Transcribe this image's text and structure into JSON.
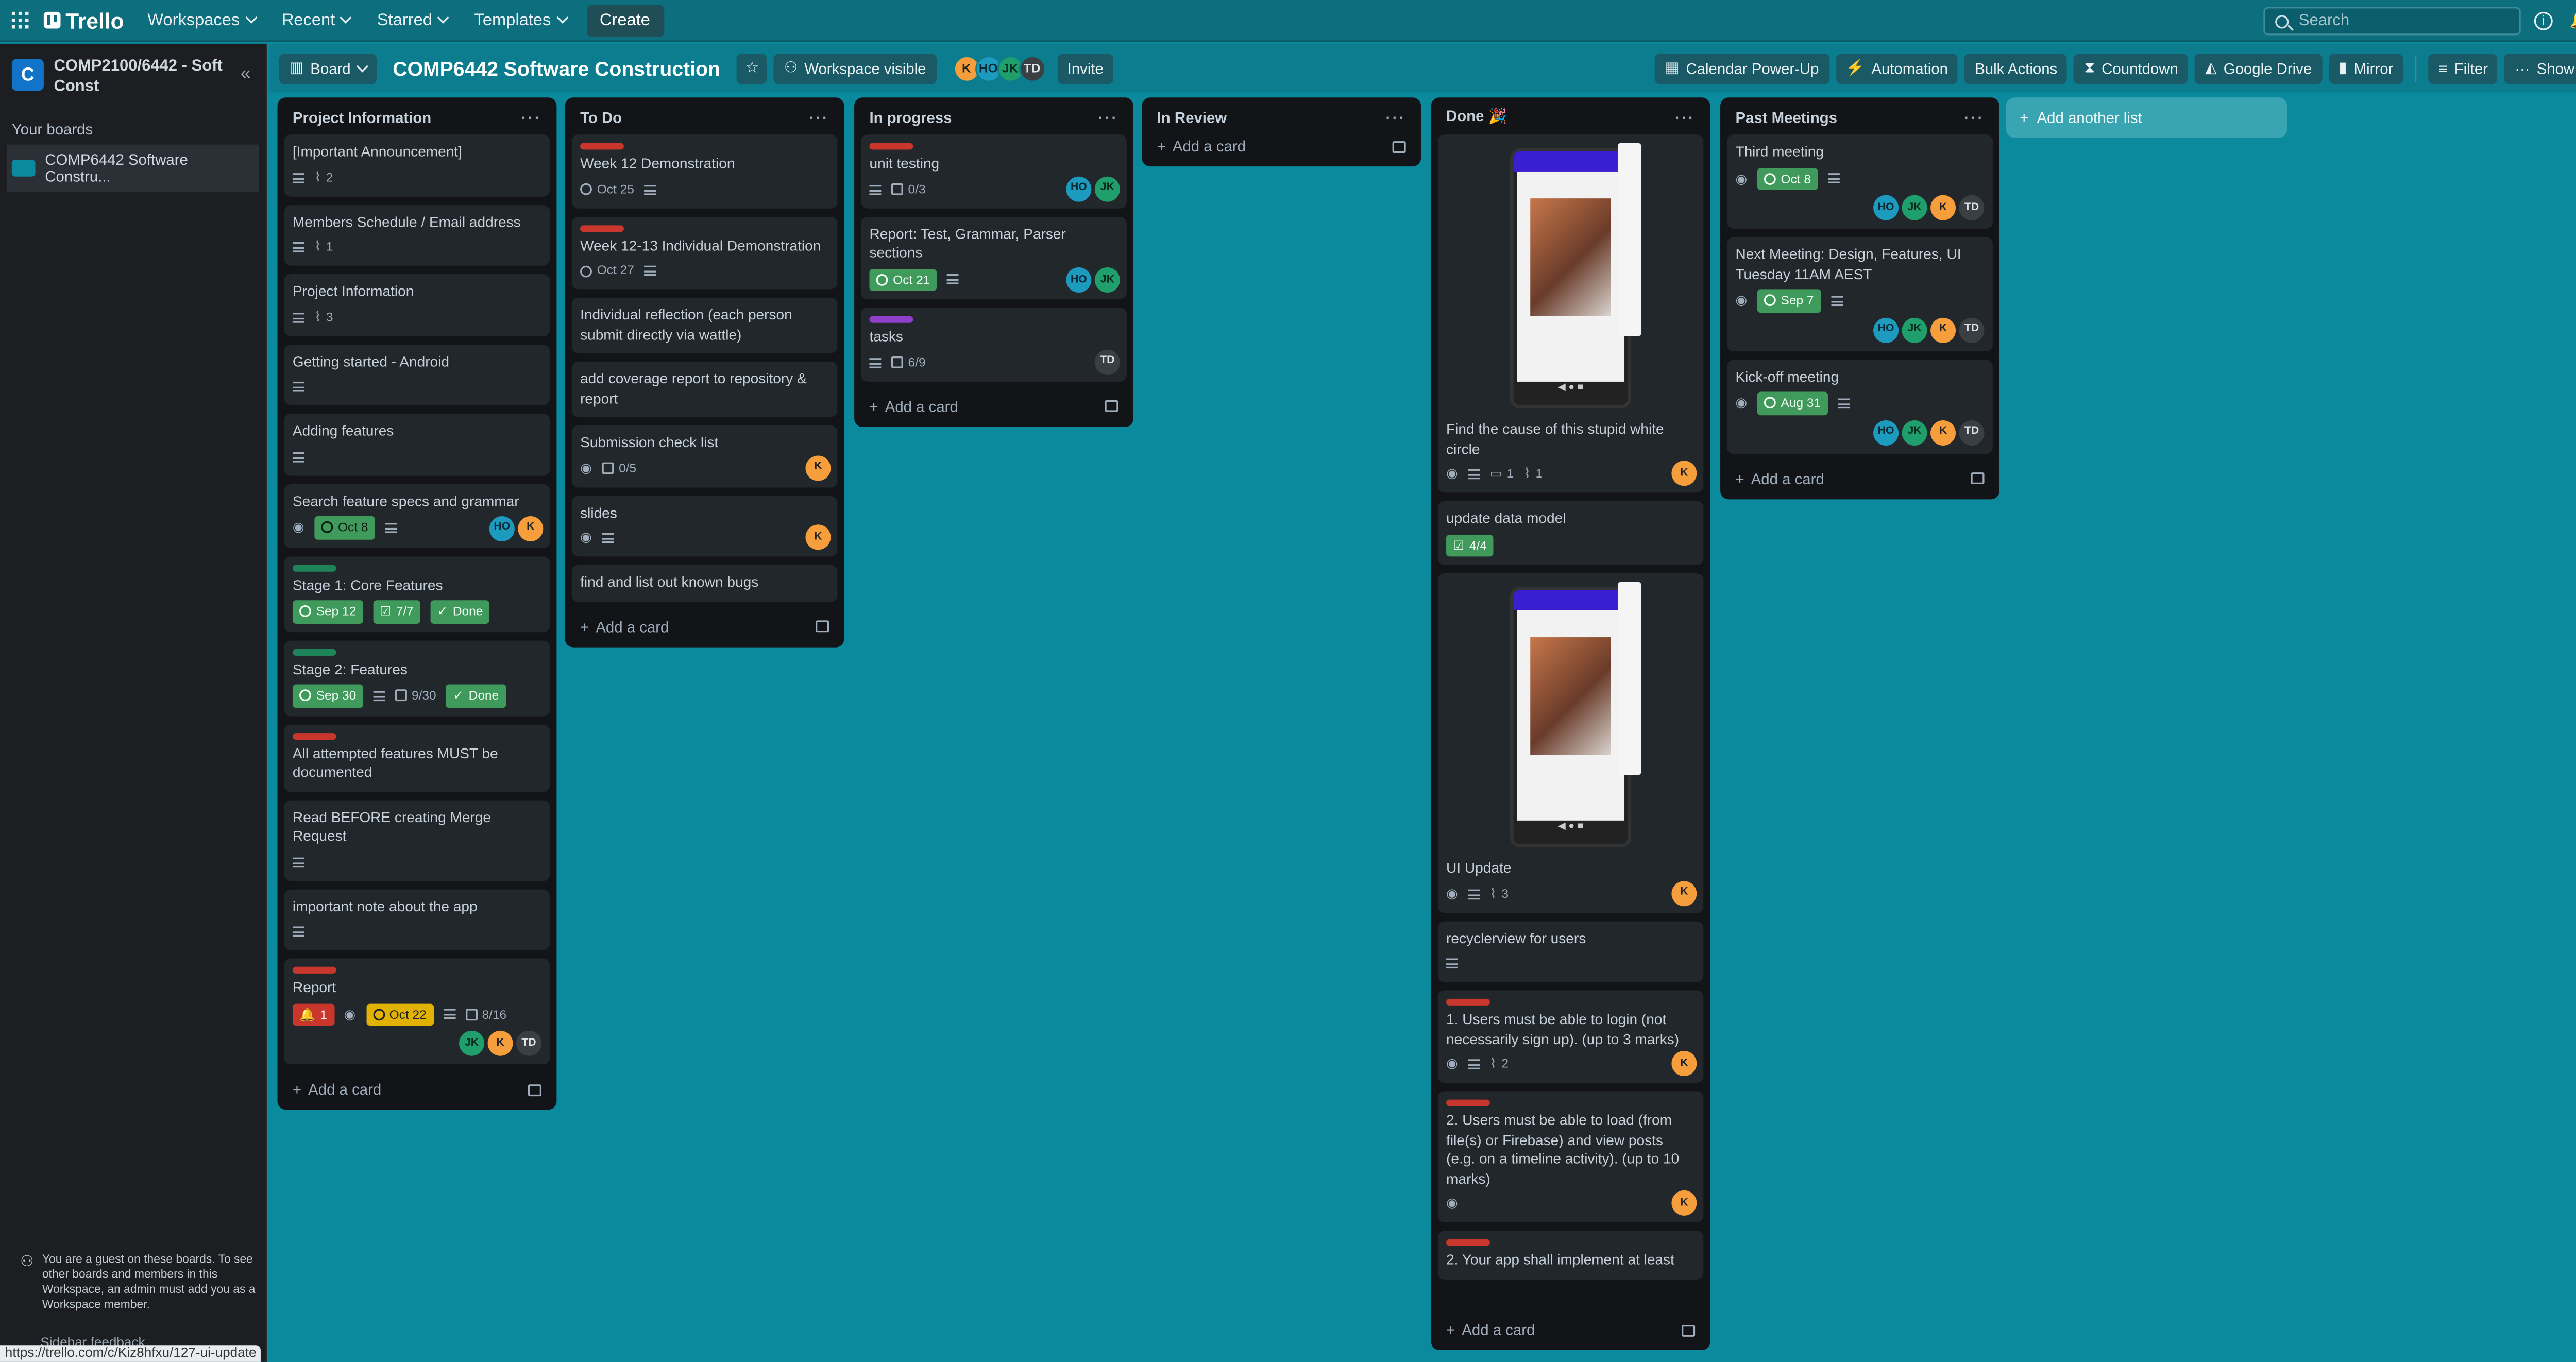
{
  "topbar": {
    "logo": "Trello",
    "nav": [
      "Workspaces",
      "Recent",
      "Starred",
      "Templates"
    ],
    "create": "Create",
    "search_placeholder": "Search",
    "user_initial": "K"
  },
  "sidebar": {
    "workspace_initial": "C",
    "workspace_name": "COMP2100/6442 - Soft Const",
    "your_boards": "Your boards",
    "board": "COMP6442 Software Constru...",
    "guest_note": "You are a guest on these boards. To see other boards and members in this Workspace, an admin must add you as a Workspace member.",
    "feedback": "Sidebar feedback"
  },
  "status_url": "https://trello.com/c/Kiz8hfxu/127-ui-update",
  "board": {
    "view": "Board",
    "title": "COMP6442 Software Construction",
    "visibility": "Workspace visible",
    "members": [
      "K",
      "HO",
      "JK",
      "TD"
    ],
    "invite": "Invite",
    "actions": [
      "Calendar Power-Up",
      "Automation",
      "Bulk Actions",
      "Countdown",
      "Google Drive",
      "Mirror"
    ],
    "filter": "Filter",
    "show_menu": "Show menu"
  },
  "add_card": "Add a card",
  "add_list": "Add another list",
  "lists": {
    "project_info": {
      "title": "Project Information",
      "cards": [
        {
          "title": "[Important Announcement]",
          "attach": "2"
        },
        {
          "title": "Members Schedule / Email address",
          "attach": "1"
        },
        {
          "title": "Project Information",
          "attach": "3"
        },
        {
          "title": "Getting started - Android"
        },
        {
          "title": "Adding features"
        },
        {
          "title": "Search feature specs and grammar",
          "date": "Oct 8"
        },
        {
          "title": "Stage 1: Core Features",
          "date": "Sep 12",
          "check": "7/7",
          "done": "Done"
        },
        {
          "title": "Stage 2: Features",
          "date": "Sep 30",
          "check": "9/30",
          "done": "Done"
        },
        {
          "title": "All attempted features MUST be documented"
        },
        {
          "title": "Read BEFORE creating Merge Request"
        },
        {
          "title": "important note about the app"
        },
        {
          "title": "Report",
          "notify": "1",
          "date": "Oct 22",
          "check": "8/16"
        }
      ]
    },
    "todo": {
      "title": "To Do",
      "cards": [
        {
          "title": "Week 12 Demonstration",
          "date": "Oct 25"
        },
        {
          "title": "Week 12-13 Individual Demonstration",
          "date": "Oct 27"
        },
        {
          "title": "Individual reflection (each person submit directly via wattle)"
        },
        {
          "title": "add coverage report to repository & report"
        },
        {
          "title": "Submission check list",
          "check": "0/5"
        },
        {
          "title": "slides"
        },
        {
          "title": "find and list out known bugs"
        }
      ]
    },
    "in_progress": {
      "title": "In progress",
      "cards": [
        {
          "title": "unit testing",
          "check": "0/3"
        },
        {
          "title": "Report: Test, Grammar, Parser sections",
          "date": "Oct 21"
        },
        {
          "title": "tasks",
          "check": "6/9"
        }
      ]
    },
    "in_review": {
      "title": "In Review"
    },
    "done": {
      "title": "Done 🎉",
      "cards": [
        {
          "title": "Find the cause of this stupid white circle",
          "comments": "1",
          "attach": "1"
        },
        {
          "title": "update data model",
          "check": "4/4"
        },
        {
          "title": "UI Update",
          "attach": "3"
        },
        {
          "title": "recyclerview for users"
        },
        {
          "title": "1. Users must be able to login (not necessarily sign up). (up to 3 marks)",
          "attach": "2"
        },
        {
          "title": "2. Users must be able to load (from file(s) or Firebase) and view posts (e.g. on a timeline activity). (up to 10 marks)"
        },
        {
          "title": "2. Your app shall implement at least"
        }
      ]
    },
    "past_meetings": {
      "title": "Past Meetings",
      "cards": [
        {
          "title": "Third meeting",
          "date": "Oct 8"
        },
        {
          "title": "Next Meeting: Design, Features, UI Tuesday 11AM AEST",
          "date": "Sep 7"
        },
        {
          "title": "Kick-off meeting",
          "date": "Aug 31"
        }
      ]
    }
  }
}
